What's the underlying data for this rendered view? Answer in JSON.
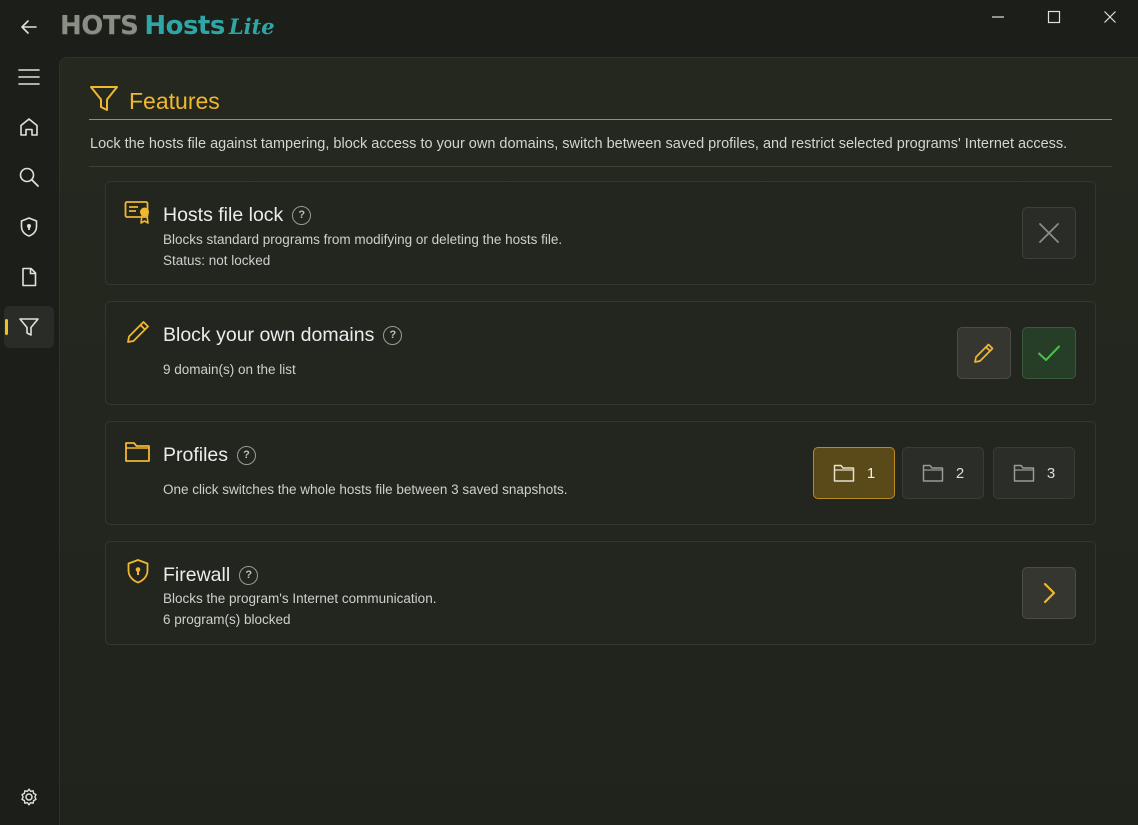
{
  "app": {
    "logo_part1": "HOTS",
    "logo_part2": "Hosts",
    "logo_part3": "Lite"
  },
  "colors": {
    "accent": "#f0b72f",
    "teal": "#2fa6a6",
    "green": "#4cc04c",
    "background": "#1c1f19"
  },
  "sidebar": {
    "items": [
      {
        "name": "menu",
        "icon": "hamburger-icon"
      },
      {
        "name": "home",
        "icon": "home-icon"
      },
      {
        "name": "search",
        "icon": "search-icon"
      },
      {
        "name": "security",
        "icon": "shield-lock-icon"
      },
      {
        "name": "hosts-file",
        "icon": "document-icon"
      },
      {
        "name": "features",
        "icon": "filter-icon",
        "active": true
      },
      {
        "name": "settings",
        "icon": "gear-icon"
      }
    ]
  },
  "page": {
    "title": "Features",
    "description": "Lock the hosts file against tampering, block access to your own domains, switch between saved profiles, and restrict selected programs' Internet access."
  },
  "help_glyph": "?",
  "cards": {
    "lock": {
      "title": "Hosts file lock",
      "line1": "Blocks standard programs from modifying or deleting the hosts file.",
      "line2": "Status: not locked"
    },
    "domains": {
      "title": "Block your own domains",
      "line1": "9 domain(s) on the list"
    },
    "profiles": {
      "title": "Profiles",
      "line1": "One click switches the whole hosts file between 3 saved snapshots.",
      "buttons": [
        "1",
        "2",
        "3"
      ],
      "active_index": 0
    },
    "firewall": {
      "title": "Firewall",
      "line1": "Blocks the program's Internet communication.",
      "line2": "6 program(s) blocked"
    }
  }
}
